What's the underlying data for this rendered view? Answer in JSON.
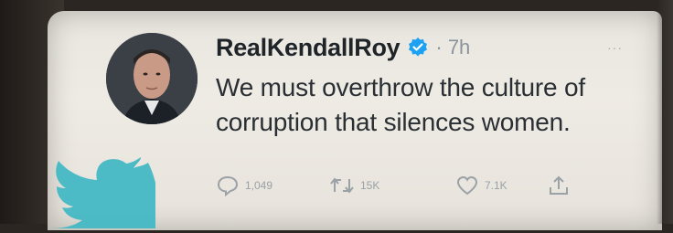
{
  "tweet": {
    "username": "RealKendallRoy",
    "time": "7h",
    "text_line1": "We must overthrow the culture of",
    "text_line2": "corruption that silences women.",
    "more_label": "···"
  },
  "actions": {
    "reply_count": "1,049",
    "retweet_count": "15K",
    "like_count": "7.1K"
  },
  "colors": {
    "verified": "#1da1f2",
    "bird": "#43b8c4",
    "text": "#2a2f34",
    "muted": "#9aa1a7"
  },
  "icons": [
    "verified-badge-icon",
    "reply-icon",
    "retweet-icon",
    "like-icon",
    "share-icon",
    "twitter-bird-icon",
    "more-icon"
  ]
}
